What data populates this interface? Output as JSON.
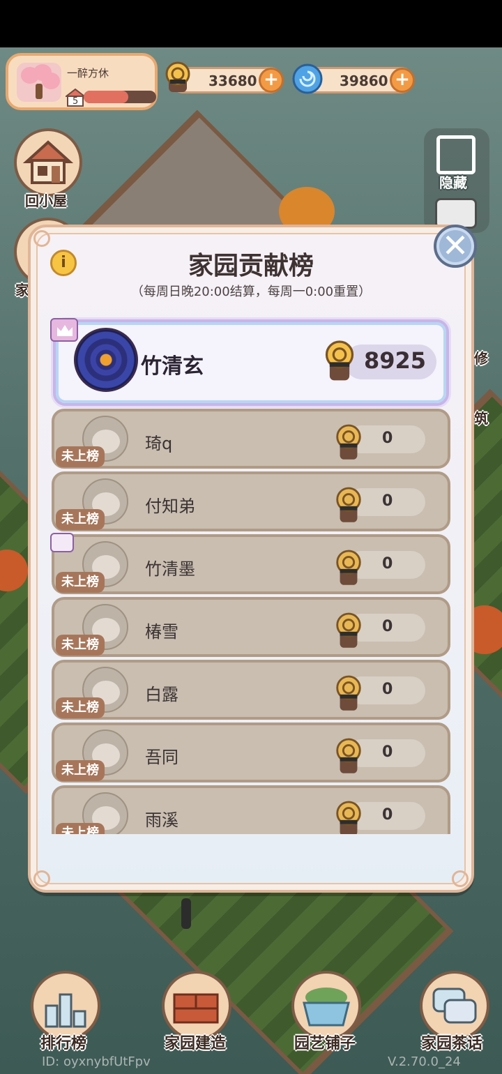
{
  "header": {
    "user_name": "一醉方休",
    "level": "5",
    "level_progress": 0.62,
    "snail_coins": "33680",
    "spiral_gems": "39860"
  },
  "side": {
    "home_label": "回小屋",
    "home_label_2": "家",
    "hide_label": "隐藏",
    "right_edge_1": "修",
    "right_edge_2": "筑"
  },
  "modal": {
    "title": "家园贡献榜",
    "subtitle": "（每周日晚20:00结算，每周一0:00重置）",
    "info_icon": "i",
    "close_icon": "✕",
    "top": {
      "name": "竹清玄",
      "score": "8925"
    },
    "unranked_label": "未上榜",
    "rows": [
      {
        "name": "琦q",
        "score": "0"
      },
      {
        "name": "付知弟",
        "score": "0"
      },
      {
        "name": "竹清墨",
        "score": "0"
      },
      {
        "name": "椿雪",
        "score": "0"
      },
      {
        "name": "白露",
        "score": "0"
      },
      {
        "name": "吾同",
        "score": "0"
      },
      {
        "name": "雨溪",
        "score": "0"
      }
    ]
  },
  "bottom_nav": {
    "ranking": "排行榜",
    "build": "家园建造",
    "shop": "园艺铺子",
    "chat": "家园茶话"
  },
  "footer": {
    "id": "ID: oyxnybfUtFpv",
    "version": "V.2.70.0_24"
  },
  "colors": {
    "accent_orange": "#f39b44",
    "panel_bg": "#f7eee6",
    "row_bg": "#c9beb0",
    "badge_brown": "#a7765a"
  }
}
